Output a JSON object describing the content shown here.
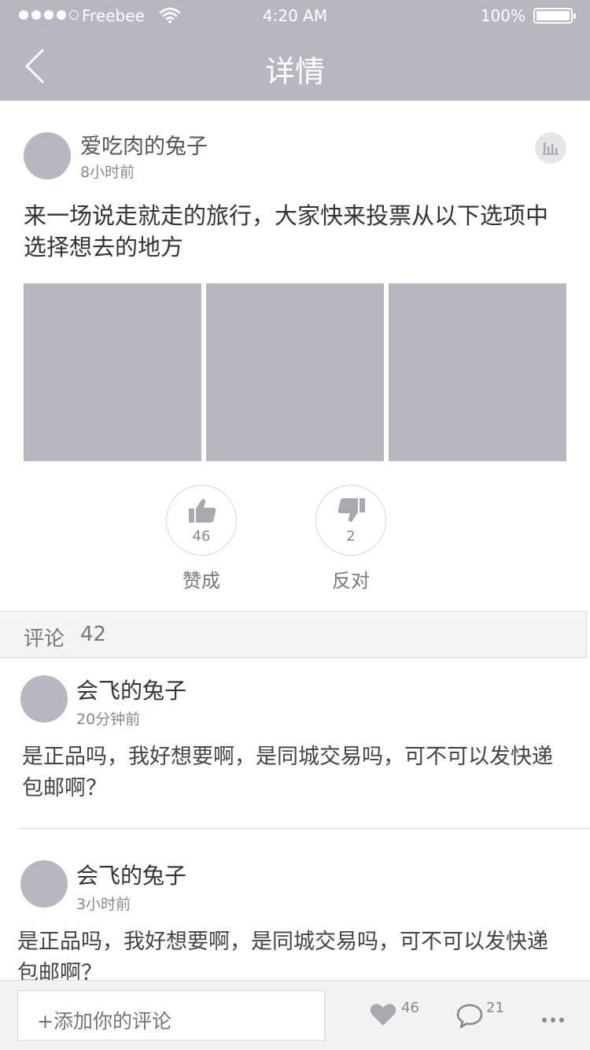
{
  "status_bar": {
    "carrier": "Freebee",
    "time": "4:20 AM",
    "battery": "100%",
    "battery_level": 1.0,
    "signal_strength": 4,
    "signal_max": 5
  },
  "nav": {
    "title": "详情"
  },
  "post": {
    "author": "爱吃肉的兔子",
    "time": "8小时前",
    "text": "来一场说走就走的旅行，大家快来投票从以下选项中选择想去的地方",
    "image_count": 3,
    "votes": {
      "agree_count": "46",
      "agree_label": "赞成",
      "oppose_count": "2",
      "oppose_label": "反对"
    }
  },
  "comments": {
    "label": "评论",
    "count": "42",
    "items": [
      {
        "author": "会飞的兔子",
        "time": "20分钟前",
        "text": "是正品吗，我好想要啊，是同城交易吗，可不可以发快递包邮啊？"
      },
      {
        "author": "会飞的兔子",
        "time": "3小时前",
        "text": "是正品吗，我好想要啊，是同城交易吗，可不可以发快递包邮啊？"
      }
    ]
  },
  "bottom_bar": {
    "input_placeholder": "+添加你的评论",
    "likes": "46",
    "comments": "21"
  },
  "colors": {
    "header": "#b8b7c1",
    "placeholder_gray": "#b8b7c1",
    "icon_gray": "#a8a8b0"
  },
  "icons": {
    "back": "chevron-left-icon",
    "stats": "bar-chart-icon",
    "agree": "thumbs-up-icon",
    "oppose": "thumbs-down-icon",
    "like": "heart-icon",
    "comment": "speech-bubble-icon",
    "more": "more-dots-icon"
  }
}
